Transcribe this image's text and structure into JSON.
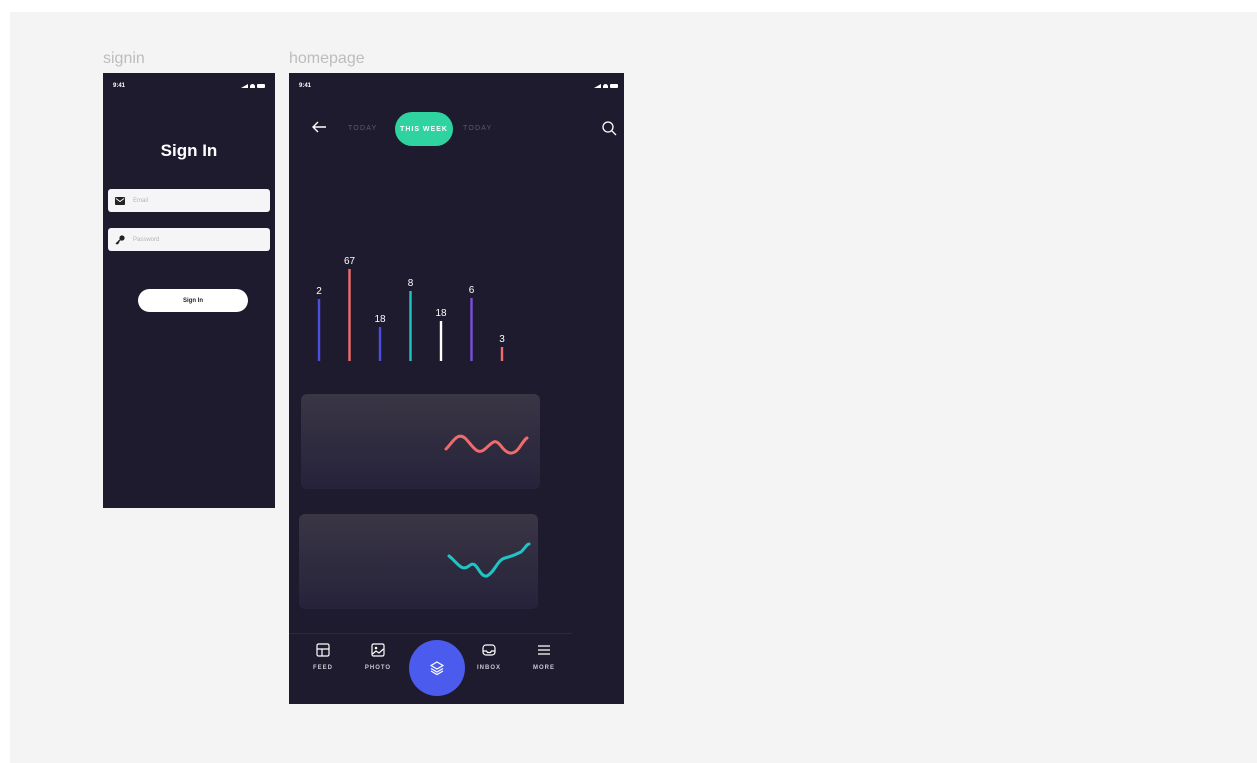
{
  "frames": {
    "signin_label": "signin",
    "homepage_label": "homepage"
  },
  "signin": {
    "status_time": "9:41",
    "title": "Sign In",
    "email_placeholder": "Email",
    "password_placeholder": "Password",
    "submit_label": "Sign In",
    "icons": [
      "mail-icon",
      "key-icon"
    ]
  },
  "homepage": {
    "status_time": "9:41",
    "tabs": {
      "left": "TODAY",
      "active": "THIS WEEK",
      "right": "TODAY"
    },
    "nav": [
      {
        "label": "FEED",
        "icon": "layout-icon"
      },
      {
        "label": "PHOTO",
        "icon": "image-icon"
      },
      {
        "label": "",
        "icon": "layers-icon"
      },
      {
        "label": "INBOX",
        "icon": "inbox-icon"
      },
      {
        "label": "MORE",
        "icon": "menu-icon"
      }
    ],
    "cards": [
      {
        "line_color": "#f06b6b"
      },
      {
        "line_color": "#20c4c4"
      }
    ]
  },
  "chart_data": {
    "type": "bar",
    "categories": [
      "",
      "",
      "",
      "",
      "",
      "",
      ""
    ],
    "values": [
      62,
      92,
      34,
      70,
      40,
      63,
      14
    ],
    "value_labels": [
      "2",
      "67",
      "18",
      "8",
      "18",
      "6",
      "3"
    ],
    "colors": [
      "#4b4fe0",
      "#f06b6b",
      "#4b4fe0",
      "#20c4c4",
      "#ffffff",
      "#7a4fe0",
      "#f06b6b"
    ],
    "title": "",
    "xlabel": "",
    "ylabel": ""
  }
}
